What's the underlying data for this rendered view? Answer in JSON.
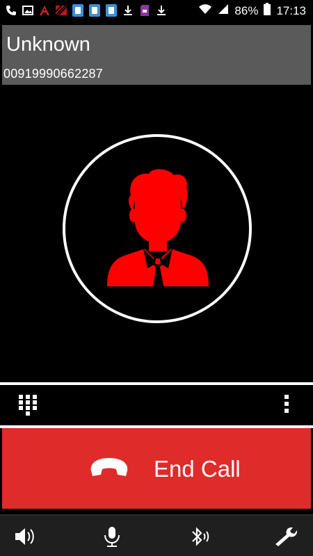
{
  "status_bar": {
    "battery_percent": "86%",
    "time": "17:13",
    "left_icons": [
      "phone-icon",
      "image-icon",
      "text-a-icon",
      "stripes-icon",
      "sim-icon",
      "sim-icon",
      "sim-icon",
      "download-icon",
      "sd-card-icon",
      "download-icon"
    ],
    "right_icons": [
      "wifi-icon",
      "signal-icon",
      "battery-icon"
    ]
  },
  "contact": {
    "name": "Unknown",
    "number": "00919990662287"
  },
  "avatar": {
    "icon": "person-icon",
    "color": "#ff0000",
    "ring_color": "#ffffff"
  },
  "controls": {
    "dialpad_icon": "dialpad-icon",
    "more_icon": "more-vertical-icon"
  },
  "end_call": {
    "label": "End Call",
    "icon": "hangup-icon",
    "color": "#e02b2b"
  },
  "bottom_bar": {
    "items": [
      {
        "icon": "speaker-icon"
      },
      {
        "icon": "mic-icon"
      },
      {
        "icon": "bluetooth-icon"
      },
      {
        "icon": "wrench-icon"
      }
    ]
  }
}
